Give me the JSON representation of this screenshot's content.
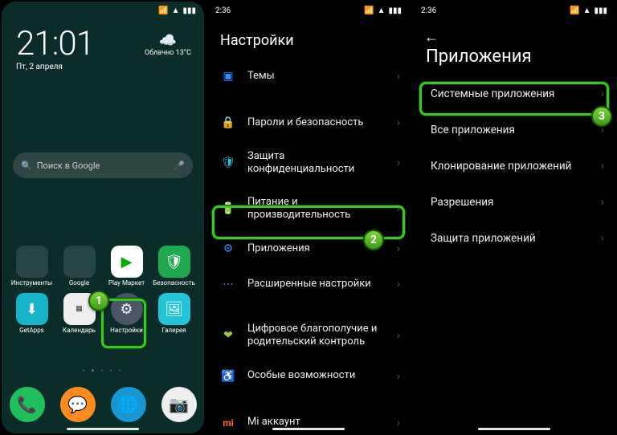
{
  "screen1": {
    "time": "21:01",
    "date": "Пт, 2 апреля",
    "weather_label": "Облачно",
    "weather_temp": "13°C",
    "search_placeholder": "Поиск в Google",
    "apps_row1": [
      {
        "name": "Инструменты"
      },
      {
        "name": "Google"
      },
      {
        "name": "Play Маркет"
      },
      {
        "name": "Безопасность"
      }
    ],
    "apps_row2": [
      {
        "name": "GetApps"
      },
      {
        "name": "Календарь"
      },
      {
        "name": "Настройки"
      },
      {
        "name": "Галерея"
      }
    ],
    "step": "1"
  },
  "screen2": {
    "status_time": "2:36",
    "title": "Настройки",
    "items": [
      {
        "icon": "square",
        "label": "Темы",
        "color": "ic-blue"
      },
      {
        "gap": true
      },
      {
        "icon": "lock",
        "label": "Пароли и безопасность",
        "color": "ic-green"
      },
      {
        "icon": "shield",
        "label": "Защита конфиденциальности",
        "color": "ic-cyan"
      },
      {
        "icon": "battery",
        "label": "Питание и производительность",
        "color": "ic-grey"
      },
      {
        "icon": "gear",
        "label": "Приложения",
        "color": "ic-blue",
        "hl": true
      },
      {
        "icon": "dots",
        "label": "Расширенные настройки",
        "color": "ic-purple"
      },
      {
        "gap": true
      },
      {
        "icon": "heart",
        "label": "Цифровое благополучие и родительский контроль",
        "color": "ic-lime"
      },
      {
        "icon": "access",
        "label": "Особые возможности",
        "color": "ic-yellow"
      },
      {
        "gap": true
      },
      {
        "icon": "mi",
        "label": "Mi аккаунт",
        "color": "ic-orange"
      }
    ],
    "step": "2"
  },
  "screen3": {
    "status_time": "2:36",
    "title": "Приложения",
    "items": [
      {
        "label": "Системные приложения",
        "hl": true
      },
      {
        "label": "Все приложения"
      },
      {
        "label": "Клонирование приложений"
      },
      {
        "label": "Разрешения"
      },
      {
        "label": "Защита приложений"
      }
    ],
    "step": "3"
  }
}
